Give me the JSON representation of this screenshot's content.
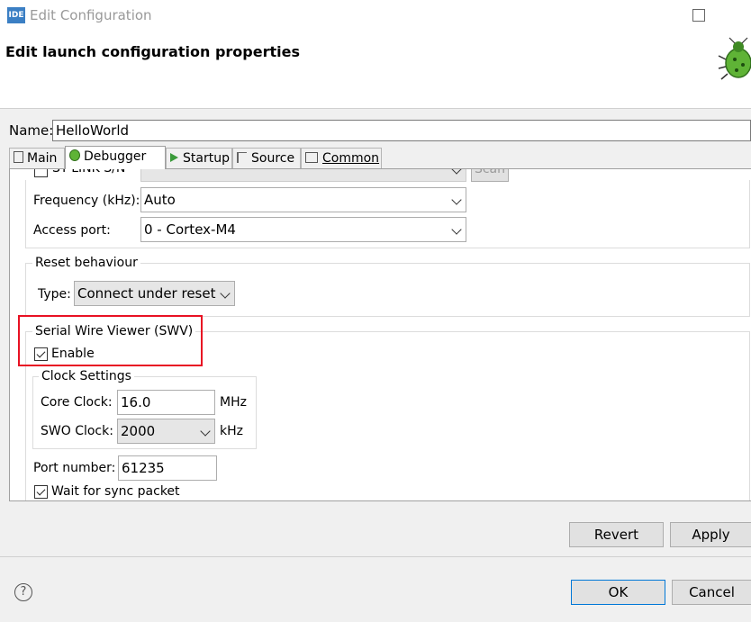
{
  "window": {
    "icon_text": "IDE",
    "title": "Edit Configuration"
  },
  "header": {
    "title": "Edit launch configuration properties",
    "icon": "bug-icon"
  },
  "name_field": {
    "label": "Name:",
    "value": "HelloWorld"
  },
  "tabs": [
    {
      "label": "Main",
      "icon": "document-icon"
    },
    {
      "label": "Debugger",
      "icon": "bug-small-icon",
      "active": true
    },
    {
      "label": "Startup",
      "icon": "play-icon"
    },
    {
      "label": "Source",
      "icon": "source-icon"
    },
    {
      "label": "Common",
      "icon": "common-icon"
    }
  ],
  "debugger": {
    "stlink_sn_label": "ST-LINK S/N",
    "scan_label": "Scan",
    "frequency_label": "Frequency (kHz):",
    "frequency_value": "Auto",
    "access_port_label": "Access port:",
    "access_port_value": "0 - Cortex-M4",
    "reset": {
      "group_title": "Reset behaviour",
      "type_label": "Type:",
      "type_value": "Connect under reset"
    },
    "swv": {
      "group_title": "Serial Wire Viewer (SWV)",
      "enable_label": "Enable",
      "enable_checked": true,
      "clock": {
        "group_title": "Clock Settings",
        "core_clock_label": "Core Clock:",
        "core_clock_value": "16.0",
        "core_clock_unit": "MHz",
        "swo_clock_label": "SWO Clock:",
        "swo_clock_value": "2000",
        "swo_clock_unit": "kHz"
      },
      "port_label": "Port number:",
      "port_value": "61235",
      "sync_label": "Wait for sync packet",
      "sync_checked": true
    }
  },
  "buttons": {
    "revert": "Revert",
    "apply": "Apply",
    "ok": "OK",
    "cancel": "Cancel",
    "help": "?"
  },
  "colors": {
    "accent": "#0078d7",
    "highlight": "#e81123",
    "app_icon": "#3b7fc4"
  }
}
